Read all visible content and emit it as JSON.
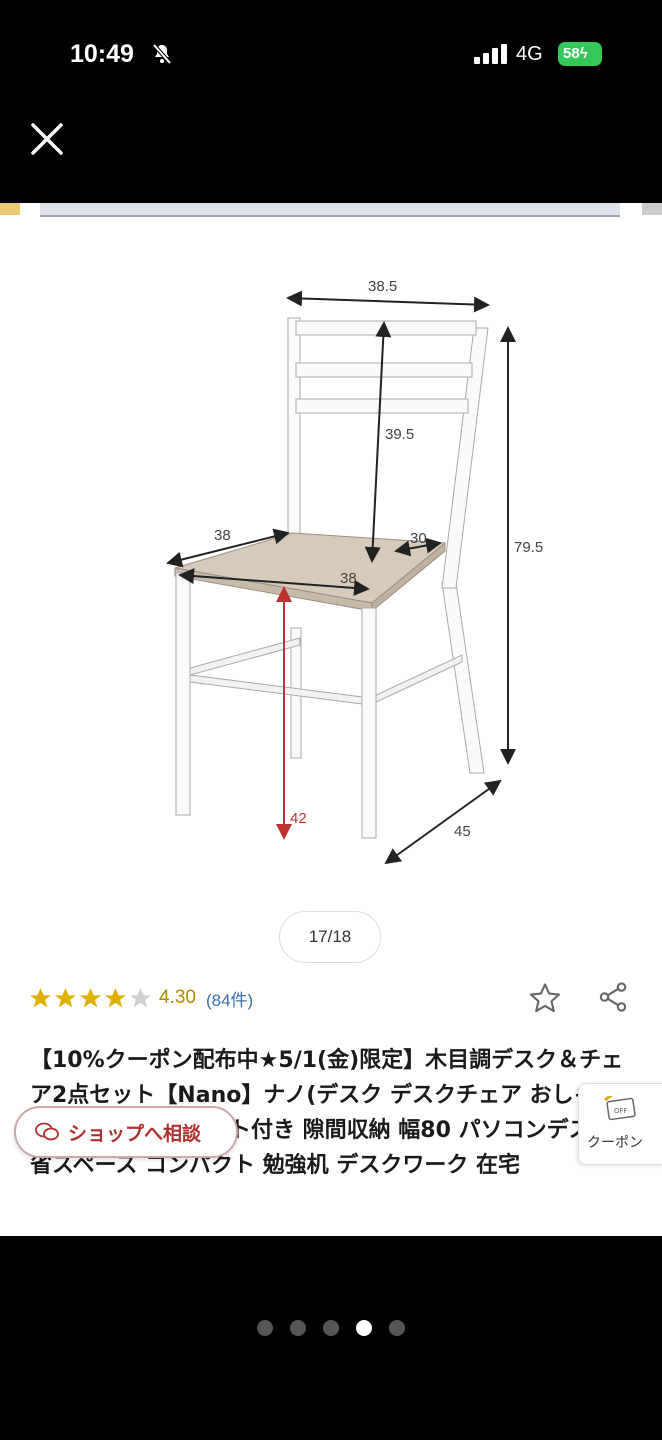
{
  "status_bar": {
    "time": "10:49",
    "network": "4G",
    "battery": "58"
  },
  "icons": {
    "silent": "bell-slash-icon",
    "signal": "signal-icon",
    "battery": "battery-charging-icon",
    "close": "close-icon",
    "favorite": "star-outline-icon",
    "share": "share-icon",
    "chat": "chat-icon",
    "coupon": "coupon-icon"
  },
  "figure": {
    "dimensions": {
      "top_width": "38.5",
      "backrest_height": "39.5",
      "total_height": "79.5",
      "seat_left": "38",
      "seat_right": "30",
      "seat_width": "38",
      "seat_height": "42",
      "depth": "45"
    }
  },
  "image_counter": "17/18",
  "rating": {
    "score": 4.3,
    "value": "4.30",
    "reviews": "(84件)",
    "filled_stars": 4,
    "total_stars": 5
  },
  "product": {
    "title": "【10%クーポン配布中★5/1(金)限定】木目調デスク＆チェア2点セット【Nano】ナノ(デスク デスクチェア おしゃれ 机 椅子 白 コンセント付き 隙間収納 幅80 パソコンデスク 省スペース コンパクト 勉強机 デスクワーク 在宅"
  },
  "shop_chip": {
    "label": "ショップへ相談"
  },
  "coupon_tab": {
    "label": "クーポン",
    "badge": "OFF"
  },
  "colors": {
    "accent_red": "#b03030",
    "star_gold": "#e0b000",
    "link_blue": "#3a6fb0",
    "battery_green": "#34c759"
  },
  "pager": {
    "total": 5,
    "active_index": 3
  }
}
